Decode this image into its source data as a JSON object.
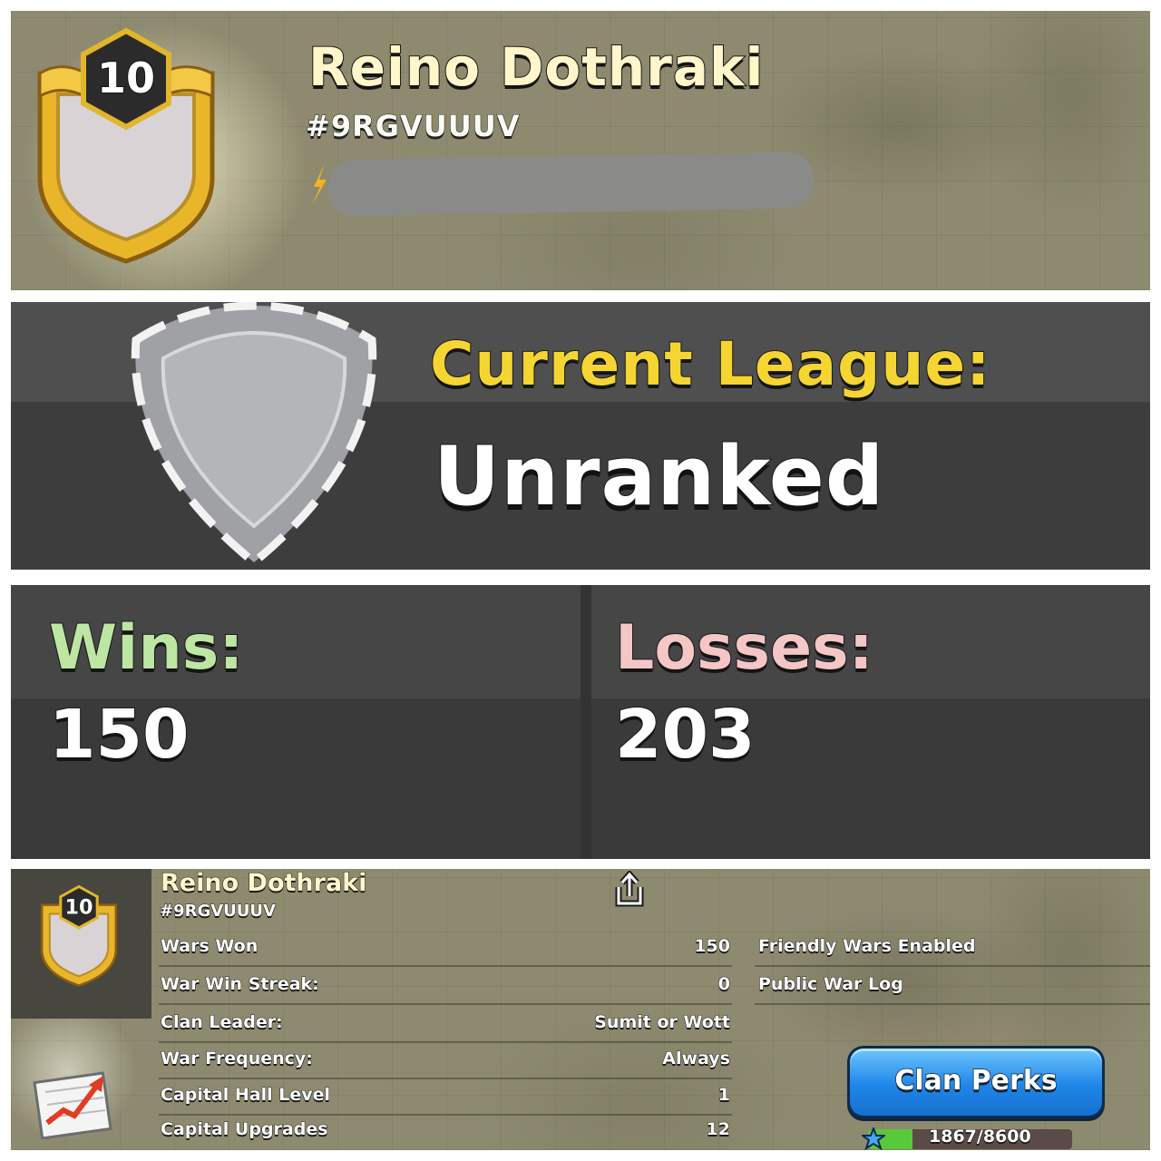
{
  "clan": {
    "name": "Reino Dothraki",
    "tag": "#9RGVUUUV",
    "level": "10"
  },
  "league": {
    "title": "Current League:",
    "value": "Unranked"
  },
  "stats": {
    "wins_label": "Wins:",
    "wins_value": "150",
    "losses_label": "Losses:",
    "losses_value": "203"
  },
  "details": {
    "rows": [
      {
        "label": "Wars Won",
        "value": "150"
      },
      {
        "label": "War Win Streak:",
        "value": "0"
      },
      {
        "label": "Clan Leader:",
        "value": "Sumit or Wott"
      },
      {
        "label": "War Frequency:",
        "value": "Always"
      },
      {
        "label": "Capital Hall Level",
        "value": "1"
      },
      {
        "label": "Capital Upgrades",
        "value": "12"
      }
    ],
    "right_rows": [
      {
        "label": "Friendly Wars Enabled"
      },
      {
        "label": "Public War Log"
      }
    ],
    "perks_button": "Clan Perks",
    "xp": {
      "text": "1867/8600",
      "fraction": 0.217
    },
    "icons": [
      "share-icon",
      "chart-icon",
      "xp-icon",
      "clan-badge-icon",
      "league-shield-icon"
    ]
  },
  "colors": {
    "title_gold": "#f5d531",
    "wins_green": "#bde6a3",
    "losses_pink": "#f4c6c6",
    "button_blue": "#1f86e8"
  }
}
